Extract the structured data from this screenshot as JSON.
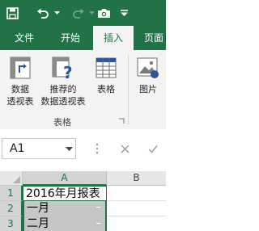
{
  "colors": {
    "brand": "#217346",
    "ribbon_bg": "#f3f3f3",
    "selection": "#c6c6c6"
  },
  "quick_access": [
    {
      "icon": "save-icon"
    },
    {
      "icon": "undo-icon"
    },
    {
      "icon": "redo-icon"
    },
    {
      "icon": "camera-icon"
    },
    {
      "icon": "customize-dropdown-icon"
    }
  ],
  "tabs": [
    "文件",
    "开始",
    "插入",
    "页面"
  ],
  "active_tab": "插入",
  "ribbon": {
    "buttons": [
      {
        "line1": "数据",
        "line2": "透视表",
        "icon": "pivot-table-icon"
      },
      {
        "line1": "推荐的",
        "line2": "数据透视表",
        "icon": "recommended-pivot-icon"
      },
      {
        "line1": "表格",
        "line2": "",
        "icon": "table-icon"
      },
      {
        "line1": "图片",
        "line2": "",
        "icon": "picture-icon"
      }
    ],
    "group_label": "表格"
  },
  "formula_bar": {
    "name_box": "A1",
    "formula": ""
  },
  "sheet": {
    "columns": [
      "A",
      "B"
    ],
    "selected_column": "A",
    "rows": [
      {
        "num": "1",
        "a": "2016年月报表",
        "b": ""
      },
      {
        "num": "2",
        "a": "一月",
        "b": ""
      },
      {
        "num": "3",
        "a": "二月",
        "b": ""
      }
    ]
  }
}
